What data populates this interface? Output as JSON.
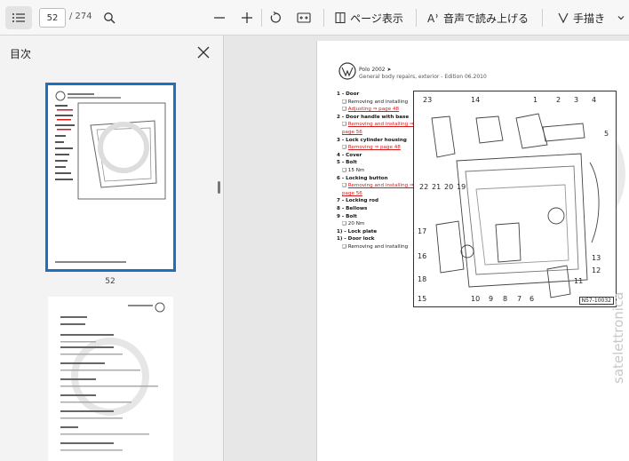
{
  "toolbar": {
    "page_current": "52",
    "page_total": "/ 274",
    "read_aloud_label": "音声で読み上げる",
    "page_view_label": "ページ表示",
    "draw_label": "手描き"
  },
  "sidebar": {
    "title": "目次",
    "thumbnails": [
      {
        "page_label": "52"
      }
    ]
  },
  "document": {
    "model": "Polo 2002 ➤",
    "subtitle": "General body repairs, exterior - Edition 06.2010",
    "figure_code": "N57-10032",
    "items": [
      {
        "num": "1",
        "title": "Door",
        "subs": [
          "Removing and installing",
          "Adjusting ⇒ page 48"
        ]
      },
      {
        "num": "2",
        "title": "Door handle with base",
        "subs": [
          "Removing and installing ⇒ page 56"
        ]
      },
      {
        "num": "3",
        "title": "Lock cylinder housing",
        "subs": [
          "Removing ⇒ page 48"
        ]
      },
      {
        "num": "4",
        "title": "Cover",
        "subs": []
      },
      {
        "num": "5",
        "title": "Bolt",
        "subs": [
          "15 Nm"
        ]
      },
      {
        "num": "6",
        "title": "Locking button",
        "subs": [
          "Removing and installing ⇒ page 56"
        ]
      },
      {
        "num": "7",
        "title": "Locking rod",
        "subs": []
      },
      {
        "num": "8",
        "title": "Bellows",
        "subs": []
      },
      {
        "num": "9",
        "title": "Bolt",
        "subs": [
          "20 Nm"
        ]
      },
      {
        "num": "1)",
        "title": "Lock plate",
        "subs": []
      },
      {
        "num": "1)",
        "title": "Door lock",
        "subs": [
          "Removing and installing"
        ]
      }
    ],
    "callouts": [
      "23",
      "14",
      "1",
      "2",
      "3",
      "4",
      "5",
      "22",
      "21",
      "20",
      "19",
      "18",
      "17",
      "16",
      "15",
      "13",
      "12",
      "11",
      "10",
      "9",
      "8",
      "7",
      "6"
    ]
  },
  "watermark": "satelettronica",
  "colors": {
    "accent": "#1f6fc0",
    "link_red": "#d21b1b"
  }
}
